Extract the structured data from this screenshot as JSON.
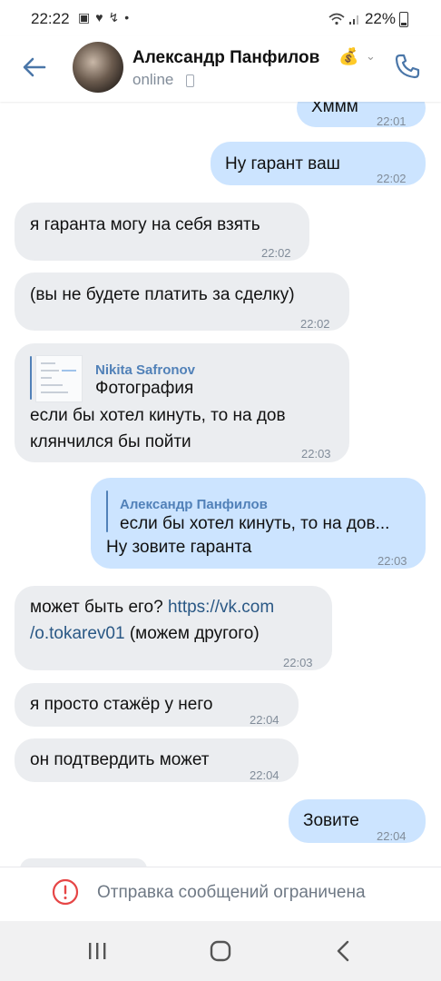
{
  "status_bar": {
    "time": "22:22",
    "battery": "22%",
    "icons": [
      "image-icon",
      "heart-icon",
      "missed-call-icon",
      "dot-icon",
      "wifi-icon",
      "signal-icon"
    ]
  },
  "header": {
    "name": "Александр Панфилов",
    "emoji": "💰",
    "presence": "online"
  },
  "messages": [
    {
      "dir": "out",
      "text": "Хммм",
      "time": "22:01"
    },
    {
      "dir": "out",
      "text": "Ну гарант ваш",
      "time": "22:02"
    },
    {
      "dir": "in",
      "text": "я гаранта могу на себя взять",
      "time": "22:02"
    },
    {
      "dir": "in",
      "text": "(вы не будете платить за сделку)",
      "time": "22:02"
    },
    {
      "dir": "in",
      "reply_name": "Nikita Safronov",
      "reply_text": "Фотография",
      "lines": [
        "если бы хотел кинуть, то на дов",
        "клянчился бы пойти"
      ],
      "time": "22:03"
    },
    {
      "dir": "out",
      "reply_name": "Александр Панфилов",
      "reply_text": "если бы хотел кинуть, то на дов...",
      "text": "Ну зовите гаранта",
      "time": "22:03"
    },
    {
      "dir": "in",
      "text_before": "может быть его? ",
      "link_a": "https://vk.com",
      "link_b": "/o.tokarev01",
      "text_after": " (можем другого)",
      "time": "22:03"
    },
    {
      "dir": "in",
      "text": "я просто стажёр у него",
      "time": "22:04"
    },
    {
      "dir": "in",
      "text": "он подтвердить может",
      "time": "22:04"
    },
    {
      "dir": "out",
      "text": "Зовите",
      "time": "22:04"
    }
  ],
  "restricted": {
    "text": "Отправка сообщений ограничена"
  },
  "colors": {
    "incoming": "#ebedf0",
    "outgoing": "#cce4ff",
    "accent": "#4a76a8",
    "error": "#e64646"
  }
}
